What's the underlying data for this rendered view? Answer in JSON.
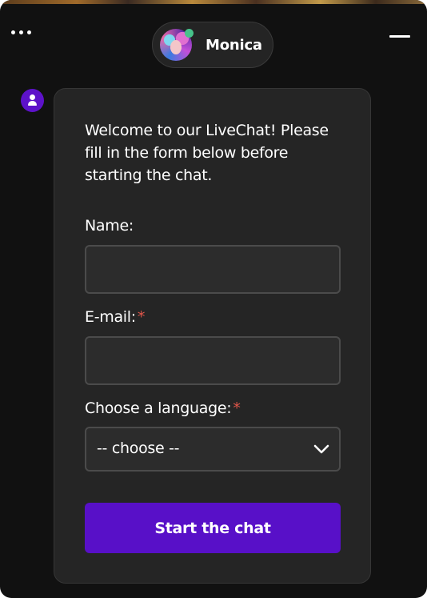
{
  "header": {
    "menu_icon": "more-horizontal-icon",
    "minimize_icon": "minimize-icon",
    "agent": {
      "name": "Monica",
      "status": "online",
      "status_color": "#46c28a"
    }
  },
  "message": {
    "avatar_icon": "user-icon",
    "avatar_color": "#5d12c9",
    "welcome_text": "Welcome to our LiveChat! Please fill in the form below before starting the chat."
  },
  "form": {
    "name": {
      "label": "Name:",
      "value": "",
      "required": false
    },
    "email": {
      "label": "E-mail:",
      "value": "",
      "required": true,
      "required_mark": "*"
    },
    "language": {
      "label": "Choose a language:",
      "selected": "-- choose --",
      "required": true,
      "required_mark": "*",
      "icon": "chevron-down-icon"
    },
    "submit_label": "Start the chat"
  },
  "colors": {
    "background": "#111111",
    "card": "#252525",
    "accent": "#5810c8",
    "required": "#e0564a"
  }
}
